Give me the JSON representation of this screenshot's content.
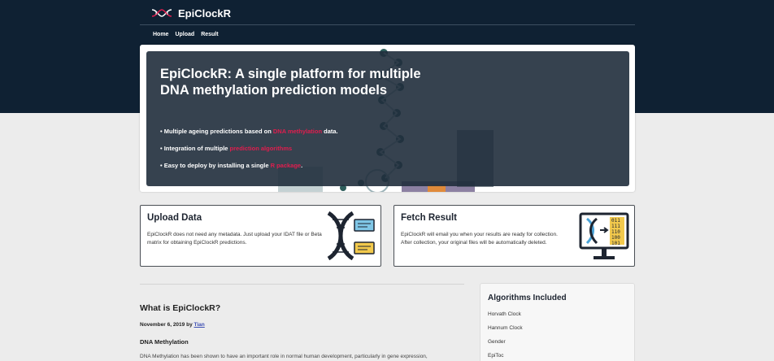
{
  "brand": {
    "name": "EpiClockR"
  },
  "nav": {
    "items": [
      "Home",
      "Upload",
      "Result"
    ]
  },
  "hero": {
    "title": "EpiClockR: A single platform for multiple DNA methylation prediction models",
    "bullets": [
      {
        "pre": "• Multiple ageing predictions based on ",
        "hl": "DNA methylation",
        "post": " data."
      },
      {
        "pre": "• Integration of multiple ",
        "hl": "prediction algorithms",
        "post": ""
      },
      {
        "pre": "• Easy to deploy by installing a single ",
        "hl": "R package",
        "post": "."
      }
    ]
  },
  "upload": {
    "title": "Upload Data",
    "text": "EpiClockR does not need any metadata. Just upload your IDAT file or Beta matrix for obtaining EpiClockR predictions."
  },
  "fetch": {
    "title": "Fetch Result",
    "text": "EpiClockR will email you when your results are ready for collection. After collection, your original files will be automatically deleted.",
    "binary": [
      "011",
      "111",
      "110",
      "100",
      "101"
    ]
  },
  "article": {
    "title": "What is EpiClockR?",
    "date": "November 6, 2019",
    "by": "by",
    "author": "Tian",
    "subheading": "DNA Methylation",
    "body": "DNA Methylation has been shown to have an important role in normal human development, particularly in gene expression,"
  },
  "sidebar": {
    "title": "Algorithms Included",
    "items": [
      "Horvath Clock",
      "Hannum Clock",
      "Gender",
      "EpiToc"
    ]
  },
  "colors": {
    "header": "#0f2133",
    "accent": "#e01d4e",
    "link": "#3d4fb3"
  }
}
